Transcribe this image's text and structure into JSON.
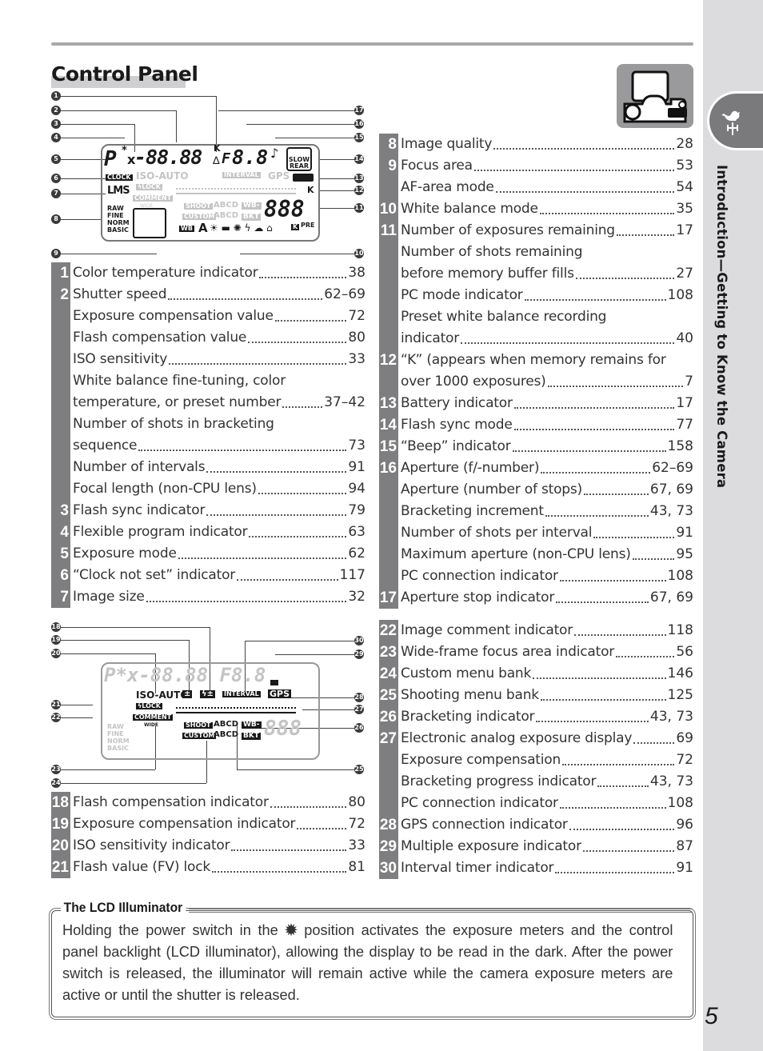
{
  "page": {
    "title": "Control Panel",
    "section_tab": "Introduction—Getting to Know the Camera",
    "page_number": "5",
    "section_icon": "weathervane-rooster-icon",
    "camera_icon": "camera-top-view-icon"
  },
  "diagram_top": {
    "callouts": [
      "1",
      "2",
      "3",
      "4",
      "5",
      "6",
      "7",
      "8",
      "9",
      "10",
      "11",
      "12",
      "13",
      "14",
      "15",
      "16",
      "17"
    ],
    "lcd": {
      "mode": "P",
      "asterisk": "*",
      "x": "x",
      "shutter": "-88.88",
      "k_small": "K",
      "delta": "∆",
      "f": "F",
      "aperture": "8.8",
      "beep": "♪",
      "clock": "CLOCK",
      "iso_auto": "ISO-AUTO",
      "interval": "INTERVAL",
      "gps": "GPS",
      "flash_lock": "ϟLOCK",
      "comment": "COMMENT",
      "size": "LMS",
      "quality": [
        "RAW",
        "FINE",
        "NORM",
        "BASIC"
      ],
      "wide": "WIDE",
      "shoot": "SHOOT",
      "custom": "CUSTOM",
      "bank": "ABCD",
      "wb_bkt": [
        "WB-",
        "BKT"
      ],
      "counter": "888",
      "k_mem": "K",
      "slow": "SLOW",
      "rear": "REAR",
      "wb": "WB",
      "wb_auto": "A",
      "pre": "PRE",
      "k_box": "K"
    }
  },
  "list_left_top": [
    {
      "num": "1",
      "label": "Color temperature indicator",
      "page": "38"
    },
    {
      "num": "2",
      "label": "Shutter speed ",
      "page": "62–69"
    },
    {
      "num": "",
      "label": "Exposure compensation value ",
      "page": "72"
    },
    {
      "num": "",
      "label": "Flash compensation value",
      "page": "80"
    },
    {
      "num": "",
      "label": "ISO sensitivity",
      "page": "33"
    },
    {
      "num": "",
      "label": "White balance fine-tuning, color",
      "page": ""
    },
    {
      "num": "",
      "label": "temperature, or preset number ",
      "page": "37–42"
    },
    {
      "num": "",
      "label": "Number of shots in bracketing",
      "page": ""
    },
    {
      "num": "",
      "label": "sequence ",
      "page": "73"
    },
    {
      "num": "",
      "label": "Number of intervals",
      "page": "91"
    },
    {
      "num": "",
      "label": "Focal length (non-CPU lens)",
      "page": "94"
    },
    {
      "num": "3",
      "label": "Flash sync indicator",
      "page": "79"
    },
    {
      "num": "4",
      "label": "Flexible program indicator ",
      "page": "63"
    },
    {
      "num": "5",
      "label": "Exposure mode",
      "page": "62"
    },
    {
      "num": "6",
      "label": "“Clock not set” indicator ",
      "page": "117"
    },
    {
      "num": "7",
      "label": "Image size ",
      "page": "32"
    }
  ],
  "list_right_top": [
    {
      "num": "8",
      "label": "Image quality ",
      "page": "28"
    },
    {
      "num": "9",
      "label": "Focus area ",
      "page": "53"
    },
    {
      "num": "",
      "label": "AF-area mode ",
      "page": "54"
    },
    {
      "num": "10",
      "label": "White balance mode",
      "page": "35"
    },
    {
      "num": "11",
      "label": "Number of exposures remaining ",
      "page": "17"
    },
    {
      "num": "",
      "label": "Number of shots remaining",
      "page": ""
    },
    {
      "num": "",
      "label": "before memory buffer fills ",
      "page": "27"
    },
    {
      "num": "",
      "label": "PC mode indicator",
      "page": "108"
    },
    {
      "num": "",
      "label": "Preset white balance recording",
      "page": ""
    },
    {
      "num": "",
      "label": "indicator ",
      "page": "40"
    },
    {
      "num": "12",
      "label": "“K” (appears when memory remains for",
      "page": ""
    },
    {
      "num": "",
      "label": "over 1000 exposures) ",
      "page": "7"
    },
    {
      "num": "13",
      "label": "Battery indicator",
      "page": "17"
    },
    {
      "num": "14",
      "label": "Flash sync mode ",
      "page": "77"
    },
    {
      "num": "15",
      "label": "“Beep” indicator",
      "page": "158"
    },
    {
      "num": "16",
      "label": "Aperture (f/-number) ",
      "page": "62–69"
    },
    {
      "num": "",
      "label": "Aperture (number of stops) ",
      "page": "67, 69"
    },
    {
      "num": "",
      "label": "Bracketing increment ",
      "page": "43, 73"
    },
    {
      "num": "",
      "label": "Number of shots per interval",
      "page": "91"
    },
    {
      "num": "",
      "label": "Maximum aperture (non-CPU lens)",
      "page": "95"
    },
    {
      "num": "",
      "label": "PC connection indicator ",
      "page": "108"
    },
    {
      "num": "17",
      "label": "Aperture stop indicator ",
      "page": "67, 69"
    }
  ],
  "diagram_bottom": {
    "callouts": [
      "18",
      "19",
      "20",
      "21",
      "22",
      "23",
      "24",
      "25",
      "26",
      "27",
      "28",
      "29",
      "30"
    ]
  },
  "list_left_bottom": [
    {
      "num": "18",
      "label": "Flash compensation indicator",
      "page": "80"
    },
    {
      "num": "19",
      "label": "Exposure compensation indicator ",
      "page": "72"
    },
    {
      "num": "20",
      "label": "ISO sensitivity indicator ",
      "page": "33"
    },
    {
      "num": "21",
      "label": "Flash value (FV) lock",
      "page": "81"
    }
  ],
  "list_right_bottom": [
    {
      "num": "22",
      "label": "Image comment indicator",
      "page": "118"
    },
    {
      "num": "23",
      "label": "Wide-frame focus area indicator",
      "page": "56"
    },
    {
      "num": "24",
      "label": "Custom menu bank",
      "page": "146"
    },
    {
      "num": "25",
      "label": "Shooting menu bank",
      "page": "125"
    },
    {
      "num": "26",
      "label": "Bracketing indicator",
      "page": "43, 73"
    },
    {
      "num": "27",
      "label": "Electronic analog exposure display ",
      "page": "69"
    },
    {
      "num": "",
      "label": "Exposure compensation ",
      "page": "72"
    },
    {
      "num": "",
      "label": "Bracketing progress indicator",
      "page": "43, 73"
    },
    {
      "num": "",
      "label": "PC connection indicator ",
      "page": "108"
    },
    {
      "num": "28",
      "label": "GPS connection indicator ",
      "page": "96"
    },
    {
      "num": "29",
      "label": "Multiple exposure indicator",
      "page": "87"
    },
    {
      "num": "30",
      "label": "Interval timer indicator ",
      "page": "91"
    }
  ],
  "note": {
    "title": "The LCD Illuminator",
    "body_before_icon": "Holding the power switch in the ",
    "icon": "lcd-illuminator-icon",
    "body_after_icon": " position activates the exposure meters and the control panel backlight (LCD illuminator), allowing the display to be read in the dark. After the power switch is released, the illuminator will remain active while the camera exposure meters are active or until the shutter is released."
  }
}
